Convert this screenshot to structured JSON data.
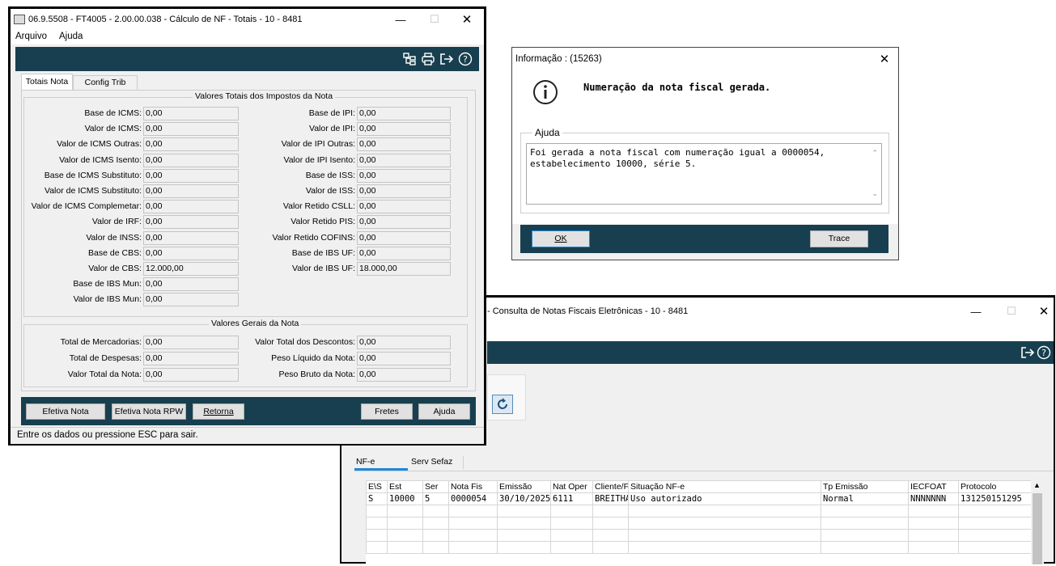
{
  "main_window": {
    "title": "06.9.5508 - FT4005 - 2.00.00.038 - Cálculo de NF - Totais - 10 - 8481",
    "menu": [
      "Arquivo",
      "Ajuda"
    ],
    "tabs": [
      "Totais Nota",
      "Config Trib"
    ],
    "group1_title": "Valores Totais dos Impostos da Nota",
    "left_fields": [
      {
        "label": "Base de ICMS:",
        "value": "0,00"
      },
      {
        "label": "Valor de ICMS:",
        "value": "0,00"
      },
      {
        "label": "Valor de ICMS Outras:",
        "value": "0,00"
      },
      {
        "label": "Valor de ICMS Isento:",
        "value": "0,00"
      },
      {
        "label": "Base de ICMS Substituto:",
        "value": "0,00"
      },
      {
        "label": "Valor de ICMS Substituto:",
        "value": "0,00"
      },
      {
        "label": "Valor de ICMS Complemetar:",
        "value": "0,00"
      },
      {
        "label": "Valor de IRF:",
        "value": "0,00"
      },
      {
        "label": "Valor de INSS:",
        "value": "0,00"
      },
      {
        "label": "Base de CBS:",
        "value": "0,00"
      },
      {
        "label": "Valor de CBS:",
        "value": "12.000,00"
      },
      {
        "label": "Base de IBS Mun:",
        "value": "0,00"
      },
      {
        "label": "Valor de IBS Mun:",
        "value": "0,00"
      }
    ],
    "right_fields": [
      {
        "label": "Base de IPI:",
        "value": "0,00"
      },
      {
        "label": "Valor de IPI:",
        "value": "0,00"
      },
      {
        "label": "Valor de IPI Outras:",
        "value": "0,00"
      },
      {
        "label": "Valor de IPI Isento:",
        "value": "0,00"
      },
      {
        "label": "Base de ISS:",
        "value": "0,00"
      },
      {
        "label": "Valor de ISS:",
        "value": "0,00"
      },
      {
        "label": "Valor Retido CSLL:",
        "value": "0,00"
      },
      {
        "label": "Valor Retido PIS:",
        "value": "0,00"
      },
      {
        "label": "Valor Retido COFINS:",
        "value": "0,00"
      },
      {
        "label": "Base de IBS UF:",
        "value": "0,00"
      },
      {
        "label": "Valor de IBS UF:",
        "value": "18.000,00"
      }
    ],
    "group2_title": "Valores Gerais da Nota",
    "gen_left": [
      {
        "label": "Total de Mercadorias:",
        "value": "0,00"
      },
      {
        "label": "Total de Despesas:",
        "value": "0,00"
      },
      {
        "label": "Valor Total da Nota:",
        "value": "0,00"
      }
    ],
    "gen_right": [
      {
        "label": "Valor Total dos Descontos:",
        "value": "0,00"
      },
      {
        "label": "Peso Líquido da Nota:",
        "value": "0,00"
      },
      {
        "label": "Peso Bruto da Nota:",
        "value": "0,00"
      }
    ],
    "buttons": {
      "efetiva": "Efetiva Nota",
      "efetiva_rpw": "Efetiva Nota RPW",
      "retorna": "Retorna",
      "fretes": "Fretes",
      "ajuda": "Ajuda"
    },
    "status": "Entre os dados ou pressione ESC para sair."
  },
  "info_dialog": {
    "title": "Informação : (15263)",
    "message": "Numeração da nota fiscal gerada.",
    "help_title": "Ajuda",
    "help_line1": "Foi gerada a nota fiscal com numeração igual a 0000054,",
    "help_line2": "estabelecimento 10000, série 5.",
    "ok": "OK",
    "trace": "Trace"
  },
  "consulta_window": {
    "title": "- Consulta de Notas Fiscais Eletrônicas - 10 - 8481",
    "tabs": [
      "NF-e",
      "Serv Sefaz"
    ],
    "columns": [
      "E\\S",
      "Est",
      "Ser",
      "Nota Fis",
      "Emissão",
      "Nat Oper",
      "Cliente/Fo",
      "Situação NF-e",
      "Tp Emissão",
      "IECFOAT",
      "Protocolo"
    ],
    "row": [
      "S",
      "10000",
      "5",
      "0000054",
      "30/10/2025",
      "6111",
      "BREITHA",
      "Uso autorizado",
      "Normal",
      "NNNNNNN",
      "131250151295"
    ]
  }
}
